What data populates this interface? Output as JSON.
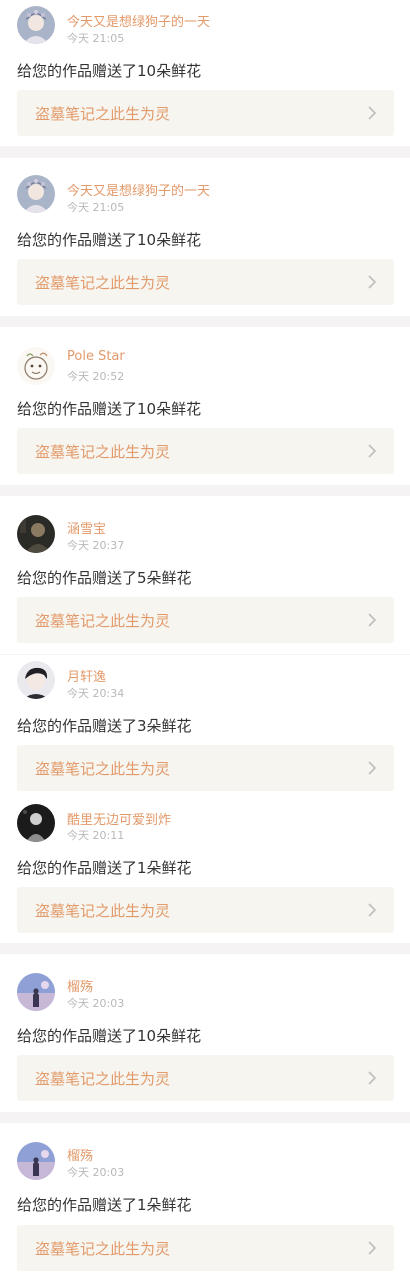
{
  "notifications": [
    {
      "username": "今天又是想绿狗子的一天",
      "time": "今天 21:05",
      "message": "给您的作品赠送了10朵鲜花",
      "work_title": "盗墓笔记之此生为灵",
      "avatar_icon": "opera-character-avatar-icon"
    },
    {
      "username": "今天又是想绿狗子的一天",
      "time": "今天 21:05",
      "message": "给您的作品赠送了10朵鲜花",
      "work_title": "盗墓笔记之此生为灵",
      "avatar_icon": "opera-character-avatar-icon"
    },
    {
      "username": "Pole Star",
      "time": "今天 20:52",
      "message": "给您的作品赠送了10朵鲜花",
      "work_title": "盗墓笔记之此生为灵",
      "avatar_icon": "cartoon-sketch-avatar-icon"
    },
    {
      "username": "涵雪宝",
      "time": "今天 20:37",
      "message": "给您的作品赠送了5朵鲜花",
      "work_title": "盗墓笔记之此生为灵",
      "avatar_icon": "dark-portrait-avatar-icon"
    },
    {
      "username": "月轩逸",
      "time": "今天 20:34",
      "message": "给您的作品赠送了3朵鲜花",
      "work_title": "盗墓笔记之此生为灵",
      "avatar_icon": "anime-boy-avatar-icon"
    },
    {
      "username": "酷里无边可爱到炸",
      "time": "今天 20:11",
      "message": "给您的作品赠送了1朵鲜花",
      "work_title": "盗墓笔记之此生为灵",
      "avatar_icon": "dark-figure-avatar-icon"
    },
    {
      "username": "榴殇",
      "time": "今天 20:03",
      "message": "给您的作品赠送了10朵鲜花",
      "work_title": "盗墓笔记之此生为灵",
      "avatar_icon": "sunset-silhouette-avatar-icon"
    },
    {
      "username": "榴殇",
      "time": "今天 20:03",
      "message": "给您的作品赠送了1朵鲜花",
      "work_title": "盗墓笔记之此生为灵",
      "avatar_icon": "sunset-silhouette-avatar-icon"
    }
  ],
  "colors": {
    "accent": "#e39a6a",
    "card_background": "#f6f5f0",
    "page_background": "#f5f3f3",
    "time_text": "#b8b8b8",
    "message_text": "#333333"
  }
}
